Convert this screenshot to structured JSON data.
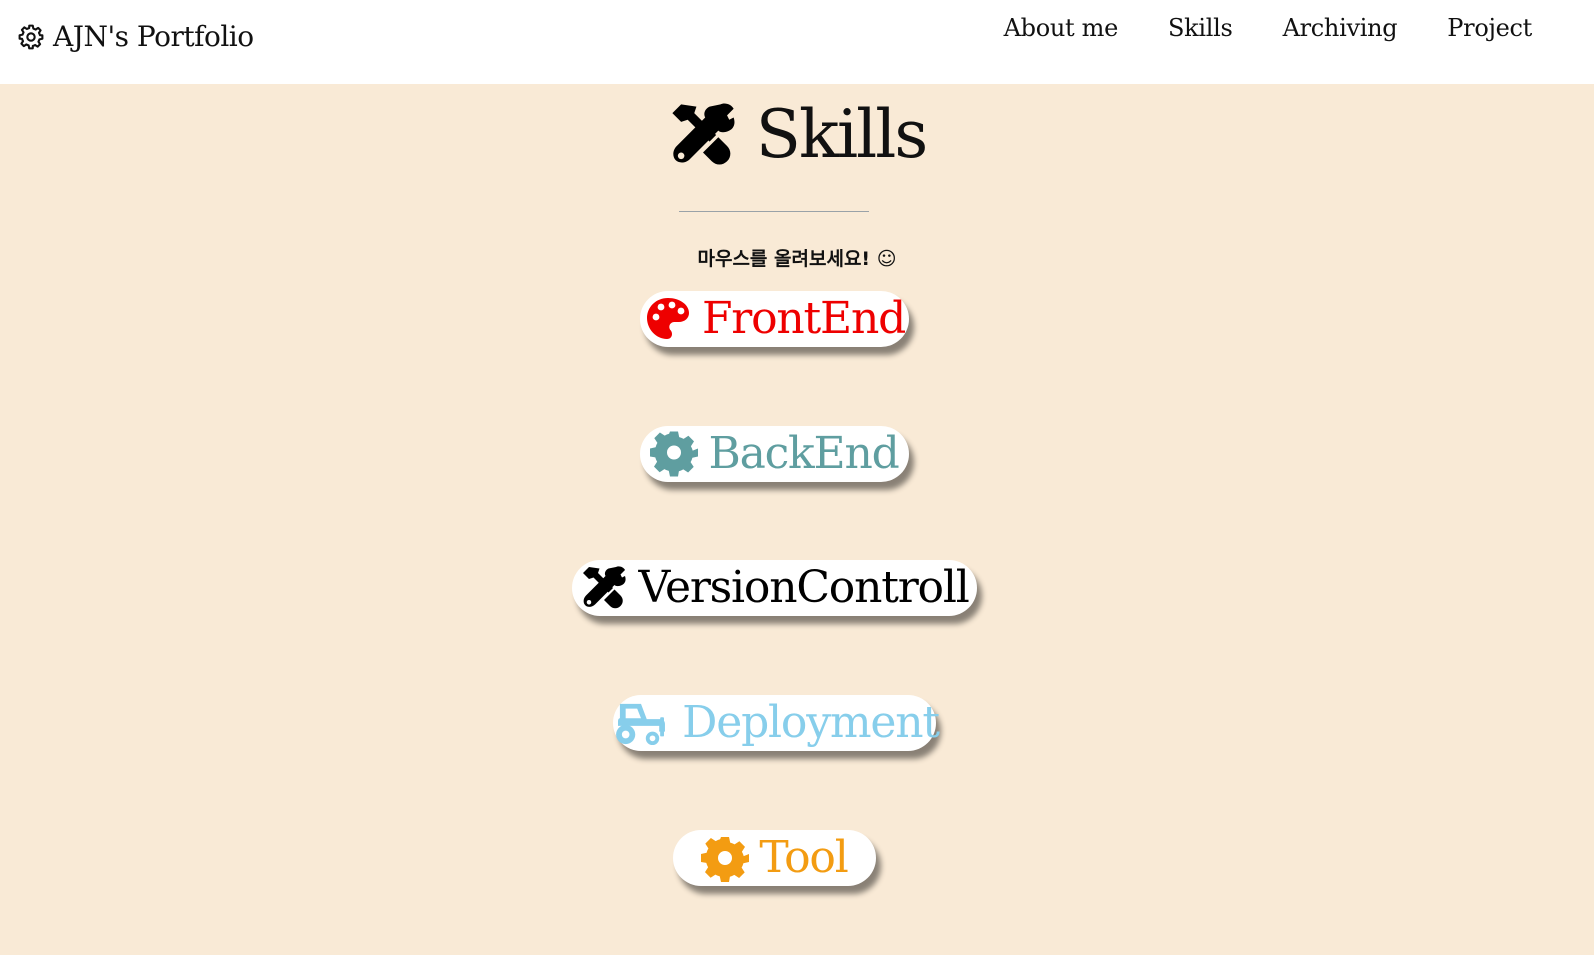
{
  "navbar": {
    "brand": "AJN's Portfolio",
    "brand_icon": "gear-icon",
    "links": [
      "About me",
      "Skills",
      "Archiving",
      "Project"
    ]
  },
  "section": {
    "title": "Skills",
    "title_icon": "tools-icon",
    "hint": "마우스를 올려보세요! ☺"
  },
  "skills": [
    {
      "label": "FrontEnd",
      "icon": "palette-icon",
      "color": "#ee0000"
    },
    {
      "label": "BackEnd",
      "icon": "cog-icon",
      "color": "#5f9ea0"
    },
    {
      "label": "VersionControll",
      "icon": "tools-icon",
      "color": "#000000"
    },
    {
      "label": "Deployment",
      "icon": "tractor-icon",
      "color": "#87ceeb"
    },
    {
      "label": "Tool",
      "icon": "cog-icon",
      "color": "#f39c12"
    }
  ],
  "colors": {
    "background": "#f9ead6",
    "navbar": "#ffffff",
    "pill": "#ffffff"
  }
}
